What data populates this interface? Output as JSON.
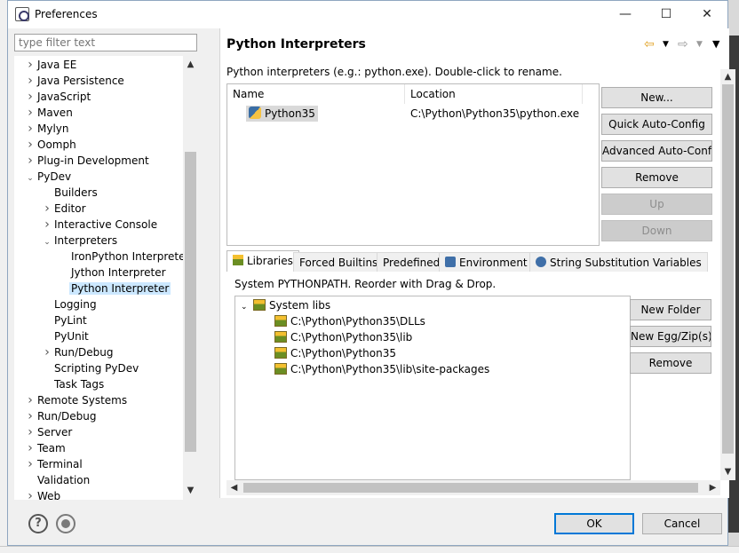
{
  "window": {
    "title": "Preferences",
    "controls": {
      "minimize": "—",
      "maximize": "☐",
      "close": "✕"
    }
  },
  "filter": {
    "placeholder": "type filter text"
  },
  "tree": {
    "items": [
      {
        "label": "Java EE",
        "expanded": false
      },
      {
        "label": "Java Persistence",
        "expanded": false
      },
      {
        "label": "JavaScript",
        "expanded": false
      },
      {
        "label": "Maven",
        "expanded": false
      },
      {
        "label": "Mylyn",
        "expanded": false
      },
      {
        "label": "Oomph",
        "expanded": false
      },
      {
        "label": "Plug-in Development",
        "expanded": false
      },
      {
        "label": "PyDev",
        "expanded": true
      },
      {
        "label": "Builders"
      },
      {
        "label": "Editor",
        "expanded": false
      },
      {
        "label": "Interactive Console",
        "expanded": false
      },
      {
        "label": "Interpreters",
        "expanded": true
      },
      {
        "label": "IronPython Interpreter"
      },
      {
        "label": "Jython Interpreter"
      },
      {
        "label": "Python Interpreter",
        "selected": true
      },
      {
        "label": "Logging"
      },
      {
        "label": "PyLint"
      },
      {
        "label": "PyUnit"
      },
      {
        "label": "Run/Debug",
        "expanded": false
      },
      {
        "label": "Scripting PyDev"
      },
      {
        "label": "Task Tags"
      },
      {
        "label": "Remote Systems",
        "expanded": false
      },
      {
        "label": "Run/Debug",
        "expanded": false
      },
      {
        "label": "Server",
        "expanded": false
      },
      {
        "label": "Team",
        "expanded": false
      },
      {
        "label": "Terminal",
        "expanded": false
      },
      {
        "label": "Validation"
      },
      {
        "label": "Web",
        "expanded": false
      }
    ]
  },
  "page": {
    "title": "Python Interpreters",
    "description": "Python interpreters (e.g.: python.exe).   Double-click to rename."
  },
  "interpreters": {
    "columns": [
      "Name",
      "Location"
    ],
    "rows": [
      {
        "name": "Python35",
        "location": "C:\\Python\\Python35\\python.exe"
      }
    ]
  },
  "interpreter_buttons": {
    "new": "New...",
    "quick": "Quick Auto-Config",
    "advanced": "Advanced Auto-Config",
    "remove": "Remove",
    "up": "Up",
    "down": "Down"
  },
  "tabs": [
    {
      "label": "Libraries",
      "active": true
    },
    {
      "label": "Forced Builtins"
    },
    {
      "label": "Predefined"
    },
    {
      "label": "Environment"
    },
    {
      "label": "String Substitution Variables"
    }
  ],
  "libraries": {
    "description": "System PYTHONPATH.   Reorder with Drag & Drop.",
    "root": "System libs",
    "paths": [
      "C:\\Python\\Python35\\DLLs",
      "C:\\Python\\Python35\\lib",
      "C:\\Python\\Python35",
      "C:\\Python\\Python35\\lib\\site-packages"
    ]
  },
  "library_buttons": {
    "new_folder": "New Folder",
    "new_egg": "New Egg/Zip(s)",
    "remove": "Remove"
  },
  "footer": {
    "help": "?",
    "ok": "OK",
    "cancel": "Cancel"
  }
}
